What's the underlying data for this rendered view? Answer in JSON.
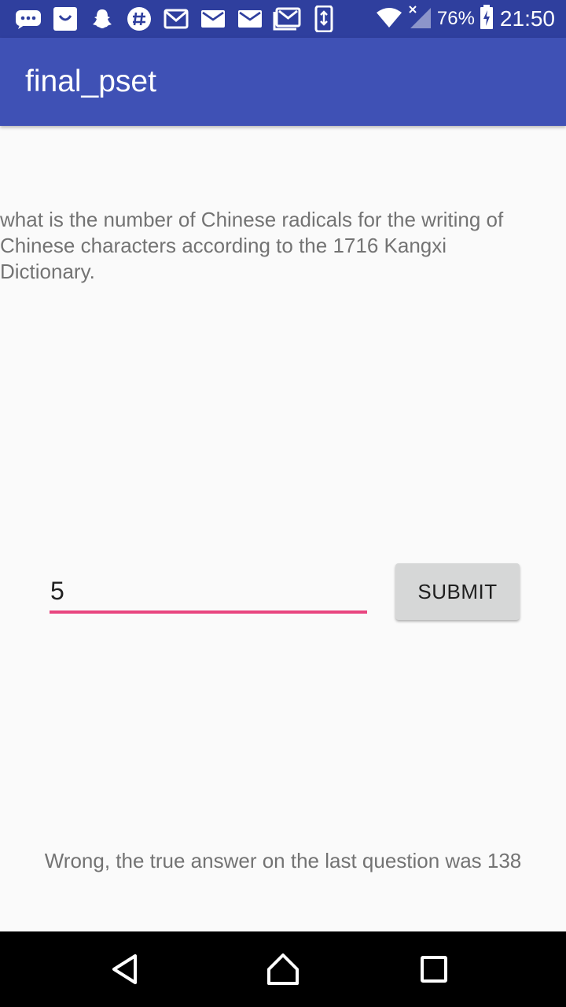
{
  "status_bar": {
    "notification_icons": [
      "chat-bubble-icon",
      "shopping-bag-icon",
      "snapchat-ghost-icon",
      "slack-hash-icon",
      "gmail-icon",
      "mail-icon",
      "mail-icon",
      "gallery-mail-icon",
      "phone-sync-icon"
    ],
    "battery_percent": "76%",
    "time": "21:50"
  },
  "app_bar": {
    "title": "final_pset"
  },
  "question": {
    "text": "what is the number of Chinese radicals for the writing of Chinese characters according to the 1716 Kangxi Dictionary."
  },
  "answer": {
    "value": "5"
  },
  "submit_button": {
    "label": "SUBMIT"
  },
  "result": {
    "text": "Wrong, the true answer on the last question was 138"
  },
  "colors": {
    "status_bar": "#2f3f9e",
    "app_bar": "#3f51b5",
    "accent": "#e8457f",
    "button": "#d6d7d7"
  }
}
